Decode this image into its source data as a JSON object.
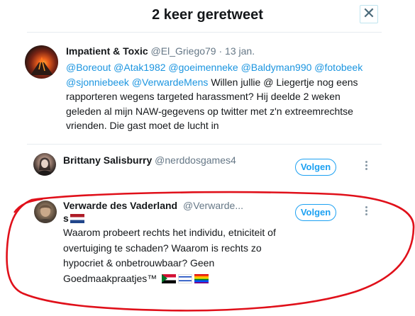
{
  "modal": {
    "title": "2 keer geretweet",
    "close_label": "✕"
  },
  "tweet": {
    "author_name": "Impatient & Toxic",
    "author_handle": "@El_Griego79",
    "separator": "·",
    "date": "13 jan.",
    "mentions": [
      "@Boreout",
      "@Atak1982",
      "@goeimenneke",
      "@Baldyman990",
      "@fotobeek",
      "@sjonniebeek",
      "@VerwardeMens"
    ],
    "body": "Willen jullie @ Liegertje nog eens rapporteren wegens targeted harassment? Hij deelde 2 weken geleden al mijn NAW-gegevens op twitter met z'n extreemrechtse vrienden. Die gast moet de lucht in",
    "avatar_icon": "volcano-avatar-icon"
  },
  "retweeters": [
    {
      "name": "Brittany Salisburry",
      "handle": "@nerddosgames4",
      "follow_label": "Volgen",
      "avatar_icon": "user-avatar-icon"
    },
    {
      "name": "Verwarde des Vaderland",
      "handle": "@Verwarde...",
      "name_suffix": "s",
      "follow_label": "Volgen",
      "bio": "Waarom probeert rechts het individu, etniciteit of overtuiging te schaden? Waarom is rechts zo hypocriet & onbetrouwbaar? Geen Goedmaakpraatjes™",
      "flags": [
        "sudan-flag",
        "israel-flag",
        "rainbow-flag"
      ],
      "name_flag": "netherlands-flag",
      "avatar_icon": "user-avatar-icon"
    }
  ],
  "colors": {
    "link": "#1b95e0",
    "follow_accent": "#1da1f2",
    "annotation_red": "#e0101a",
    "muted_text": "#657786"
  }
}
